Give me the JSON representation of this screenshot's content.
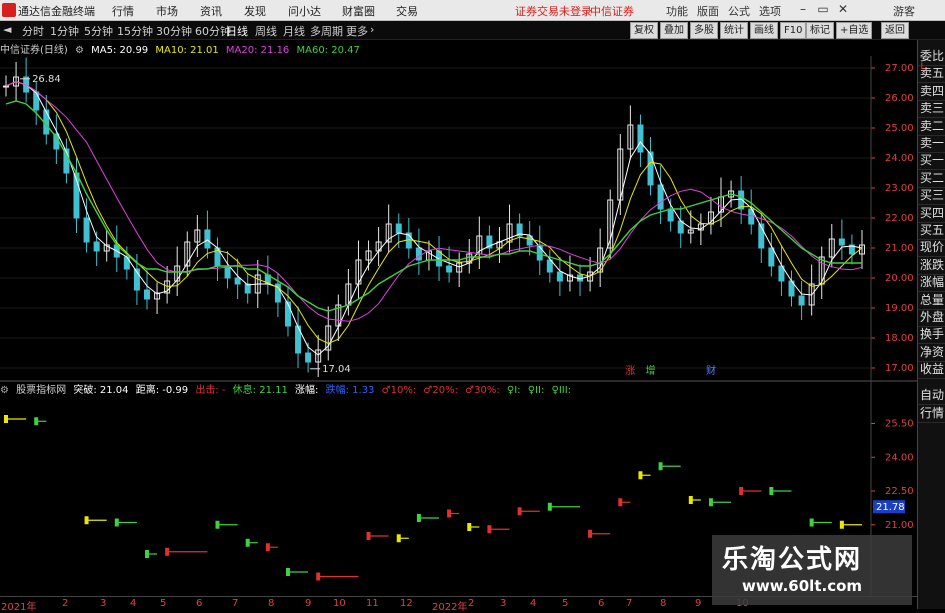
{
  "app": {
    "name": "通达信金融终端",
    "menu": [
      "行情",
      "市场",
      "资讯",
      "发现",
      "问小达",
      "财富圈",
      "交易"
    ],
    "status_text": [
      "证券交易未登录",
      "中信证券"
    ],
    "right_menu": [
      "功能",
      "版面",
      "公式",
      "选项"
    ],
    "guest": "游客"
  },
  "toolbar": {
    "periods": [
      "分时",
      "1分钟",
      "5分钟",
      "15分钟",
      "30分钟",
      "60分钟",
      "日线",
      "周线",
      "月线",
      "多周期",
      "更多"
    ],
    "active": "日线",
    "right_buttons": [
      "复权",
      "叠加",
      "多股",
      "统计",
      "画线",
      "F10",
      "标记",
      "+自选",
      "返回"
    ]
  },
  "stock": {
    "title": "中信证券(日线)",
    "ma": [
      {
        "label": "MA5: 20.99",
        "color": "#ffffff"
      },
      {
        "label": "MA10: 21.01",
        "color": "#e8e800"
      },
      {
        "label": "MA20: 21.16",
        "color": "#e040e0"
      },
      {
        "label": "MA60: 20.47",
        "color": "#40d040"
      }
    ],
    "high_marker": "26.84",
    "low_marker": "17.04",
    "events": [
      "涨",
      "增",
      "财"
    ]
  },
  "main_axis": [
    "27.00",
    "26.00",
    "25.00",
    "24.00",
    "23.00",
    "22.00",
    "21.00",
    "20.00",
    "19.00",
    "18.00",
    "17.00"
  ],
  "right_panel": [
    "委比",
    "卖五",
    "卖四",
    "卖三",
    "卖二",
    "卖一",
    "买一",
    "买二",
    "买三",
    "买四",
    "买五",
    "现价",
    "涨跌",
    "涨幅",
    "总量",
    "外盘",
    "换手",
    "净资",
    "收益"
  ],
  "right_panel_bottom": [
    "自动",
    "行情"
  ],
  "indicator": {
    "name": "股票指标网",
    "fields": [
      {
        "label": "突破: 21.04",
        "color": "#ffffff"
      },
      {
        "label": "距离: -0.99",
        "color": "#ffffff"
      },
      {
        "label": "出击: -",
        "color": "#e03030"
      },
      {
        "label": "休息: 21.11",
        "color": "#40d040"
      },
      {
        "label": "涨幅:",
        "color": "#ffffff"
      },
      {
        "label": "跌幅: 1.33",
        "color": "#3060ff"
      },
      {
        "label": "♂10%:",
        "color": "#e03030"
      },
      {
        "label": "♂20%:",
        "color": "#e03030"
      },
      {
        "label": "♂30%:",
        "color": "#e03030"
      },
      {
        "label": "♀I:",
        "color": "#40d040"
      },
      {
        "label": "♀II:",
        "color": "#40d040"
      },
      {
        "label": "♀III:",
        "color": "#40d040"
      }
    ],
    "axis": [
      "25.50",
      "24.00",
      "22.50",
      "21.00"
    ],
    "current_value": "21.78"
  },
  "time_axis": [
    "2021年",
    "2",
    "3",
    "4",
    "5",
    "6",
    "7",
    "8",
    "9",
    "10",
    "11",
    "12",
    "2022年",
    "2",
    "3",
    "4",
    "5",
    "6",
    "7",
    "8",
    "9",
    "10"
  ],
  "watermark": {
    "line1": "乐淘公式网",
    "line2": "www.60lt.com"
  },
  "chart_data": {
    "type": "line",
    "main": {
      "y_range": [
        16.8,
        27.4
      ],
      "close": [
        26.4,
        26.7,
        26.2,
        25.6,
        24.8,
        24.3,
        23.5,
        22.0,
        21.2,
        20.9,
        21.1,
        20.7,
        20.3,
        19.6,
        19.3,
        19.5,
        19.9,
        20.4,
        21.2,
        21.6,
        21.0,
        20.4,
        20.0,
        19.8,
        19.5,
        20.1,
        19.8,
        19.2,
        18.4,
        17.5,
        17.2,
        17.6,
        18.4,
        19.1,
        19.8,
        20.6,
        20.9,
        21.2,
        21.8,
        21.5,
        21.0,
        20.6,
        20.9,
        20.4,
        20.2,
        20.5,
        20.8,
        21.4,
        21.0,
        21.2,
        21.8,
        21.4,
        21.1,
        20.6,
        20.2,
        19.9,
        20.1,
        19.9,
        20.2,
        21.0,
        22.6,
        24.3,
        25.1,
        24.2,
        23.1,
        22.3,
        21.9,
        21.5,
        21.6,
        21.8,
        22.2,
        22.7,
        22.9,
        22.3,
        21.8,
        21.0,
        20.4,
        19.9,
        19.4,
        19.1,
        19.8,
        20.7,
        21.3,
        21.1,
        20.8,
        21.1
      ],
      "ma60": [
        25.8,
        25.9,
        25.8,
        25.5,
        25.1,
        24.7,
        24.1,
        23.5,
        22.8,
        22.2,
        21.6,
        21.1,
        20.8,
        20.5,
        20.3,
        20.3,
        20.2,
        20.2,
        20.2,
        20.3,
        20.3,
        20.4,
        20.4,
        20.4,
        20.3,
        20.3,
        20.1,
        19.9,
        19.7,
        19.4,
        19.2,
        19.0,
        18.9,
        19.0,
        19.1,
        19.3,
        19.5,
        19.8,
        20.0,
        20.2,
        20.4,
        20.5,
        20.6,
        20.6,
        20.6,
        20.6,
        20.7,
        20.7,
        20.7,
        20.8,
        20.8,
        20.9,
        20.9,
        20.8,
        20.7,
        20.6,
        20.5,
        20.4,
        20.4,
        20.5,
        20.8,
        21.2,
        21.6,
        21.9,
        22.1,
        22.2,
        22.3,
        22.3,
        22.4,
        22.5,
        22.6,
        22.7,
        22.8,
        22.7,
        22.5,
        22.2,
        21.9,
        21.6,
        21.3,
        21.0,
        20.8,
        20.6,
        20.5,
        20.5,
        20.5,
        20.5
      ]
    },
    "indicator_series": {
      "y_range": [
        18.5,
        26.5
      ],
      "segments": [
        [
          0,
          2,
          25.7,
          "#e8e800"
        ],
        [
          3,
          4,
          25.6,
          "#40d040"
        ],
        [
          8,
          10,
          21.2,
          "#e8e800"
        ],
        [
          11,
          13,
          21.1,
          "#40d040"
        ],
        [
          14,
          15,
          19.7,
          "#40d040"
        ],
        [
          16,
          20,
          19.8,
          "#e03030"
        ],
        [
          21,
          23,
          21.0,
          "#40d040"
        ],
        [
          24,
          25,
          20.2,
          "#40d040"
        ],
        [
          26,
          27,
          20.0,
          "#e03030"
        ],
        [
          28,
          30,
          18.9,
          "#40d040"
        ],
        [
          31,
          35,
          18.7,
          "#e03030"
        ],
        [
          36,
          38,
          20.5,
          "#e03030"
        ],
        [
          39,
          40,
          20.4,
          "#e8e800"
        ],
        [
          41,
          43,
          21.3,
          "#40d040"
        ],
        [
          44,
          45,
          21.5,
          "#e03030"
        ],
        [
          46,
          47,
          20.9,
          "#e8e800"
        ],
        [
          48,
          50,
          20.8,
          "#e03030"
        ],
        [
          51,
          53,
          21.6,
          "#e03030"
        ],
        [
          54,
          57,
          21.8,
          "#40d040"
        ],
        [
          58,
          60,
          20.6,
          "#e03030"
        ],
        [
          61,
          62,
          22.0,
          "#e03030"
        ],
        [
          63,
          64,
          23.2,
          "#e8e800"
        ],
        [
          65,
          67,
          23.6,
          "#40d040"
        ],
        [
          68,
          69,
          22.1,
          "#e8e800"
        ],
        [
          70,
          72,
          22.0,
          "#40d040"
        ],
        [
          73,
          75,
          22.5,
          "#e03030"
        ],
        [
          76,
          78,
          22.5,
          "#40d040"
        ],
        [
          80,
          82,
          21.1,
          "#40d040"
        ],
        [
          83,
          85,
          21.0,
          "#e8e800"
        ]
      ]
    }
  }
}
